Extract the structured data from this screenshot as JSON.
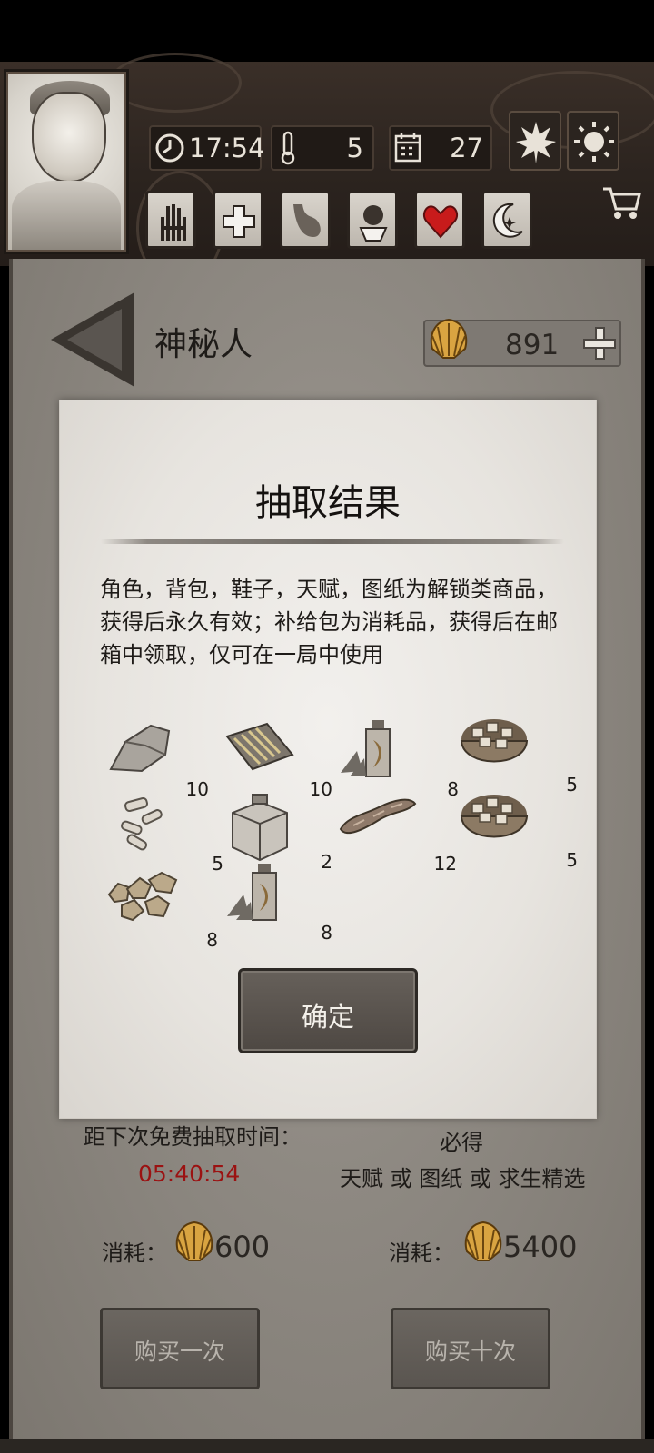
{
  "hud": {
    "time": "17:54",
    "temperature": "5",
    "day": "27"
  },
  "header": {
    "title": "神秘人",
    "currency_value": "891"
  },
  "dialog": {
    "title": "抽取结果",
    "description": "角色，背包，鞋子，天赋，图纸为解锁类商品，获得后永久有效；补给包为消耗品，获得后在邮箱中领取，仅可在一局中使用",
    "items": [
      {
        "icon": "stone-icon",
        "count": "10"
      },
      {
        "icon": "wood-planks-icon",
        "count": "10"
      },
      {
        "icon": "herb-bottle-icon",
        "count": "8"
      },
      {
        "icon": "food-bowl-icon",
        "count": "5"
      },
      {
        "icon": "bone-pieces-icon",
        "count": "5"
      },
      {
        "icon": "metal-box-icon",
        "count": "2"
      },
      {
        "icon": "meat-strip-icon",
        "count": "12"
      },
      {
        "icon": "food-bowl-icon",
        "count": "5"
      },
      {
        "icon": "ore-nuggets-icon",
        "count": "8"
      },
      {
        "icon": "herb-bottle-icon",
        "count": "8"
      }
    ],
    "confirm_label": "确定"
  },
  "shop": {
    "free_draw_label": "距下次免费抽取时间：",
    "free_draw_timer": "05:40:54",
    "guaranteed_label": "必得",
    "guaranteed_items": "天赋 或 图纸 或 求生精选",
    "cost_label_1": "消耗：",
    "cost_value_1": "600",
    "cost_label_10": "消耗：",
    "cost_value_10": "5400",
    "buy_once_label": "购买一次",
    "buy_ten_label": "购买十次"
  },
  "colors": {
    "timer_red": "#9b1212",
    "health_red": "#c81b1b",
    "shell_gold": "#d9a441"
  }
}
